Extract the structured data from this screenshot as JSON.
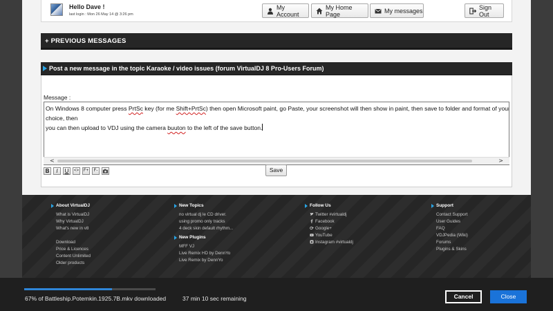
{
  "colors": {
    "accent": "#29a5e6",
    "progress": "#2f86d8",
    "close_button": "#1a73d9"
  },
  "header": {
    "greeting": "Hello Dave !",
    "last_login": "last login : Mon 26 May 14 @ 3:26 pm",
    "buttons": [
      {
        "label": "My Account",
        "icon": "user-icon"
      },
      {
        "label": "My Home Page",
        "icon": "home-icon"
      },
      {
        "label": "My messages",
        "icon": "envelope-icon"
      },
      {
        "label": "Sign Out",
        "icon": "sign-out-icon"
      }
    ]
  },
  "previous_messages": {
    "label": "+ PREVIOUS MESSAGES"
  },
  "post": {
    "title": "Post a new message in the topic Karaoke / video issues (forum VirtualDJ 8 Pro-Users Forum)",
    "message_label": "Message :",
    "message_parts": {
      "p1": "On Windows 8 computer press ",
      "w1": "PrtSc",
      "p2": " key (for me ",
      "w2": "Shift+PrtSc",
      "p3": ") then open Microsoft paint, go Paste, your screenshot will then show in paint, then save to folder and format of your choice, then ",
      "p4": "you can then upload to VDJ using the camera ",
      "w3": "buuton",
      "p5": " to the left of the save button."
    },
    "toolbar": [
      "B",
      "I",
      "U",
      "<>",
      "F+",
      "F-",
      "img"
    ],
    "save_label": "Save",
    "scroll_left": "<",
    "scroll_right": ">"
  },
  "footer": {
    "about": {
      "heading": "About VirtualDJ",
      "links": [
        "What is VirtualDJ",
        "Why VirtualDJ",
        "What's new in v8"
      ],
      "links2": [
        "Download",
        "Price & Licences",
        "Content Unlimited",
        "Older products"
      ]
    },
    "new_topics": {
      "heading": "New Topics",
      "links": [
        "no virtual dj le CD driver.",
        "using promo only tracks",
        "4 deck skin default rhythm..."
      ]
    },
    "new_plugins": {
      "heading": "New Plugins",
      "links": [
        "MFF VJ",
        "Live Remix HD by DennYo",
        "Live Remix by DennYo"
      ]
    },
    "follow_us": {
      "heading": "Follow Us",
      "links": [
        "Twitter #virtualdj",
        "Facebook",
        "Google+",
        "YouTube",
        "Instagram #virtualdj"
      ]
    },
    "support": {
      "heading": "Support",
      "links": [
        "Contact Support",
        "User Guides",
        "FAQ",
        "VDJPedia (Wiki)",
        "Forums",
        "Plugins & Skins"
      ]
    }
  },
  "download": {
    "progress_percent": 67,
    "file_status": "67% of Battleship.Potemkin.1925.7B.mkv downloaded",
    "time_remaining": "37 min 10 sec remaining",
    "cancel_label": "Cancel",
    "close_label": "Close"
  }
}
